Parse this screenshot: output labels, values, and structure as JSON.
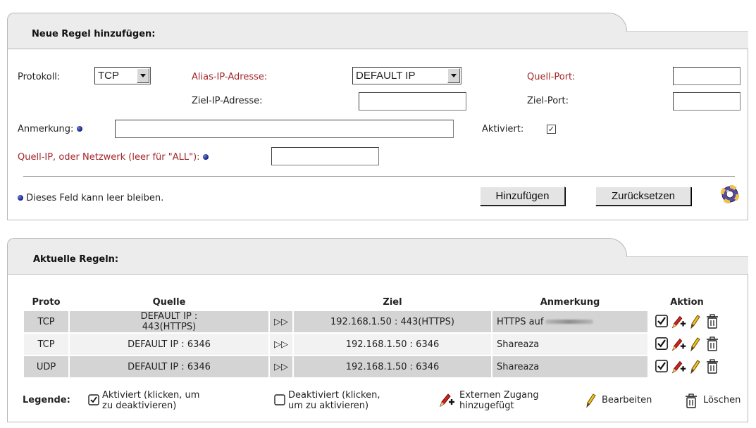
{
  "add_rule": {
    "title": "Neue Regel hinzufügen:",
    "protocol_label": "Protokoll:",
    "protocol_value": "TCP",
    "alias_ip_label": "Alias-IP-Adresse:",
    "alias_ip_value": "DEFAULT IP",
    "dest_ip_label": "Ziel-IP-Adresse:",
    "dest_ip_value": "",
    "source_port_label": "Quell-Port:",
    "source_port_value": "",
    "dest_port_label": "Ziel-Port:",
    "dest_port_value": "",
    "note_label": "Anmerkung:",
    "note_value": "",
    "active_label": "Aktiviert:",
    "active_checked": true,
    "source_ip_label": "Quell-IP, oder Netzwerk (leer für \"ALL\"):",
    "source_ip_value": "",
    "hint": "Dieses Feld kann leer bleiben.",
    "add_button": "Hinzufügen",
    "reset_button": "Zurücksetzen",
    "help_icon": "help-lifebuoy-icon"
  },
  "current_rules": {
    "title": "Aktuelle Regeln:",
    "columns": {
      "proto": "Proto",
      "source": "Quelle",
      "dest": "Ziel",
      "note": "Anmerkung",
      "action": "Aktion"
    },
    "rows": [
      {
        "proto": "TCP",
        "source": "DEFAULT IP : 443(HTTPS)",
        "dest": "192.168.1.50 : 443(HTTPS)",
        "note": "HTTPS auf",
        "active": true
      },
      {
        "proto": "TCP",
        "source": "DEFAULT IP : 6346",
        "dest": "192.168.1.50 : 6346",
        "note": "Shareaza",
        "active": true
      },
      {
        "proto": "UDP",
        "source": "DEFAULT IP : 6346",
        "dest": "192.168.1.50 : 6346",
        "note": "Shareaza",
        "active": true
      }
    ]
  },
  "legend": {
    "label": "Legende:",
    "active_line1": "Aktiviert (klicken, um",
    "active_line2": "zu deaktivieren)",
    "inactive_line1": "Deaktiviert (klicken,",
    "inactive_line2": "um zu aktivieren)",
    "external_line1": "Externen Zugang",
    "external_line2": "hinzugefügt",
    "edit": "Bearbeiten",
    "delete": "Löschen"
  },
  "colors": {
    "required_label": "#a3262a",
    "row_dark": "#d4d4d4",
    "row_light": "#f2f2f2",
    "panel_tab": "#ececec"
  }
}
